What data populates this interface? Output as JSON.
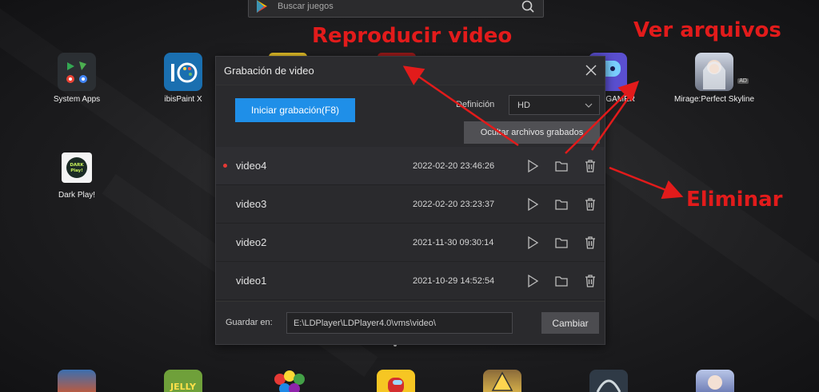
{
  "search": {
    "placeholder": "Buscar juegos"
  },
  "desktop": {
    "apps": [
      {
        "label": "System Apps",
        "icon": "system-apps-icon"
      },
      {
        "label": "ibisPaint X",
        "icon": "ibispaint-icon"
      },
      {
        "label": "GAMER",
        "icon": "gamer-icon"
      },
      {
        "label": "Mirage:Perfect Skyline",
        "icon": "mirage-icon",
        "badge": "AD"
      },
      {
        "label": "Dark Play!",
        "icon": "dark-play-icon"
      }
    ]
  },
  "dialog": {
    "title": "Grabación de video",
    "start_button": "Iniciar grabación(F8)",
    "definition_label": "Definición",
    "definition_value": "HD",
    "hide_button": "Ocultar archivos grabados",
    "videos": [
      {
        "name": "video4",
        "date": "2022-02-20 23:46:26",
        "active": true
      },
      {
        "name": "video3",
        "date": "2022-02-20 23:23:37",
        "active": false
      },
      {
        "name": "video2",
        "date": "2021-11-30 09:30:14",
        "active": false
      },
      {
        "name": "video1",
        "date": "2021-10-29 14:52:54",
        "active": false
      }
    ],
    "save_label": "Guardar en:",
    "save_path": "E:\\LDPlayer\\LDPlayer4.0\\vms\\video\\",
    "change_button": "Cambiar"
  },
  "annotations": {
    "play": "Reproducir video",
    "files": "Ver arquivos",
    "delete": "Eliminar",
    "color": "#e21b1b"
  },
  "colors": {
    "accent": "#1f8fe8",
    "dialog_bg": "#2a2a2d",
    "recording_dot": "#e53935"
  }
}
